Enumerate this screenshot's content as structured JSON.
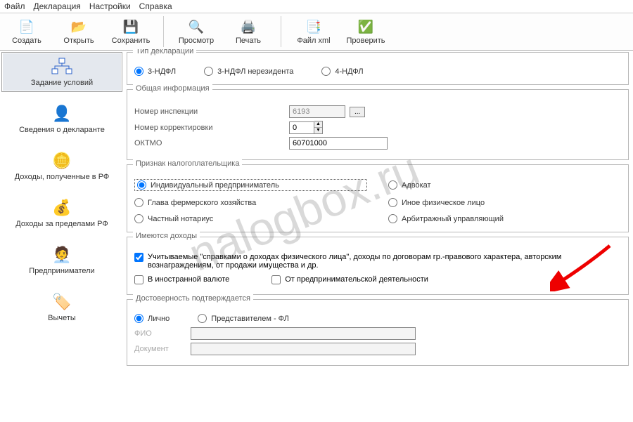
{
  "menu": {
    "file": "Файл",
    "decl": "Декларация",
    "settings": "Настройки",
    "help": "Справка"
  },
  "toolbar": {
    "create": "Создать",
    "open": "Открыть",
    "save": "Сохранить",
    "preview": "Просмотр",
    "print": "Печать",
    "xml": "Файл xml",
    "check": "Проверить"
  },
  "sidebar": {
    "items": [
      {
        "label": "Задание условий"
      },
      {
        "label": "Сведения о декларанте"
      },
      {
        "label": "Доходы, полученные в РФ"
      },
      {
        "label": "Доходы за пределами РФ"
      },
      {
        "label": "Предприниматели"
      },
      {
        "label": "Вычеты"
      }
    ]
  },
  "form": {
    "decl_type": {
      "legend": "Тип декларации",
      "opt1": "3-НДФЛ",
      "opt2": "3-НДФЛ нерезидента",
      "opt3": "4-НДФЛ",
      "selected": "opt1"
    },
    "general": {
      "legend": "Общая информация",
      "inspection_label": "Номер инспекции",
      "inspection_value": "6193",
      "correction_label": "Номер корректировки",
      "correction_value": "0",
      "oktmo_label": "ОКТМО",
      "oktmo_value": "60701000"
    },
    "taxpayer": {
      "legend": "Признак налогоплательщика",
      "opt1": "Индивидуальный предприниматель",
      "opt2": "Адвокат",
      "opt3": "Глава фермерского хозяйства",
      "opt4": "Иное физическое лицо",
      "opt5": "Частный нотариус",
      "opt6": "Арбитражный управляющий",
      "selected": "opt1"
    },
    "income": {
      "legend": "Имеются доходы",
      "chk1": "Учитываемые \"справками о доходах физического лица\", доходы по договорам гр.-правового характера, авторским вознаграждениям, от продажи имущества и др.",
      "chk2": "В иностранной валюте",
      "chk3": "От предпринимательской деятельности"
    },
    "auth": {
      "legend": "Достоверность подтверждается",
      "opt1": "Лично",
      "opt2": "Представителем - ФЛ",
      "fio_label": "ФИО",
      "fio_value": "",
      "doc_label": "Документ",
      "doc_value": ""
    }
  },
  "watermark": "nalogbox.ru"
}
